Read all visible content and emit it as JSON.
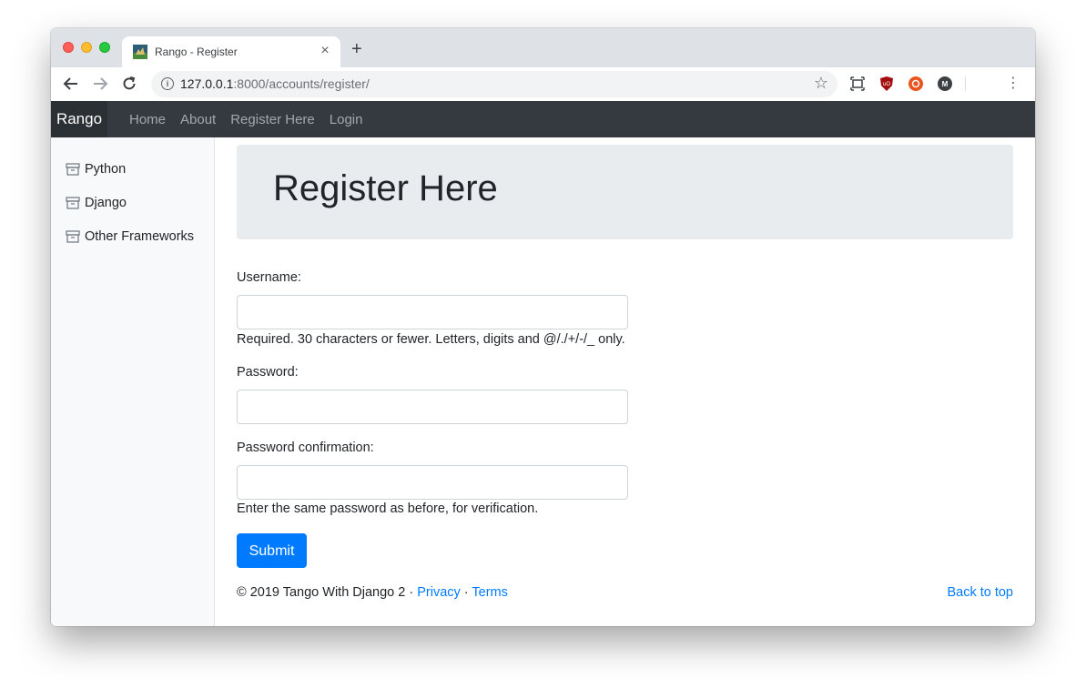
{
  "browser": {
    "tab_title": "Rango - Register",
    "tab_close": "×",
    "new_tab": "+",
    "url_host": "127.0.0.1",
    "url_rest": ":8000/accounts/register/",
    "menu": "⋮"
  },
  "navbar": {
    "brand": "Rango",
    "links": [
      "Home",
      "About",
      "Register Here",
      "Login"
    ]
  },
  "sidebar": {
    "items": [
      "Python",
      "Django",
      "Other Frameworks"
    ]
  },
  "main": {
    "heading": "Register Here",
    "form": {
      "username_label": "Username:",
      "username_value": "",
      "username_help": "Required. 30 characters or fewer. Letters, digits and @/./+/-/_ only.",
      "password_label": "Password:",
      "password_value": "",
      "password2_label": "Password confirmation:",
      "password2_value": "",
      "password2_help": "Enter the same password as before, for verification.",
      "submit_label": "Submit"
    }
  },
  "footer": {
    "copyright": "© 2019 Tango With Django 2 · ",
    "privacy": "Privacy",
    "separator": " · ",
    "terms": "Terms",
    "back_to_top": "Back to top"
  },
  "colors": {
    "navbar_bg": "#343a40",
    "primary": "#007bff",
    "jumbotron_bg": "#e9ecef",
    "sidebar_bg": "#f8f9fa"
  },
  "icons": [
    "back-arrow-icon",
    "forward-arrow-icon",
    "reload-icon",
    "info-icon",
    "star-icon",
    "screen-capture-icon",
    "ublock-icon",
    "ubuntu-extension-icon",
    "m-extension-icon",
    "archive-box-icon"
  ]
}
